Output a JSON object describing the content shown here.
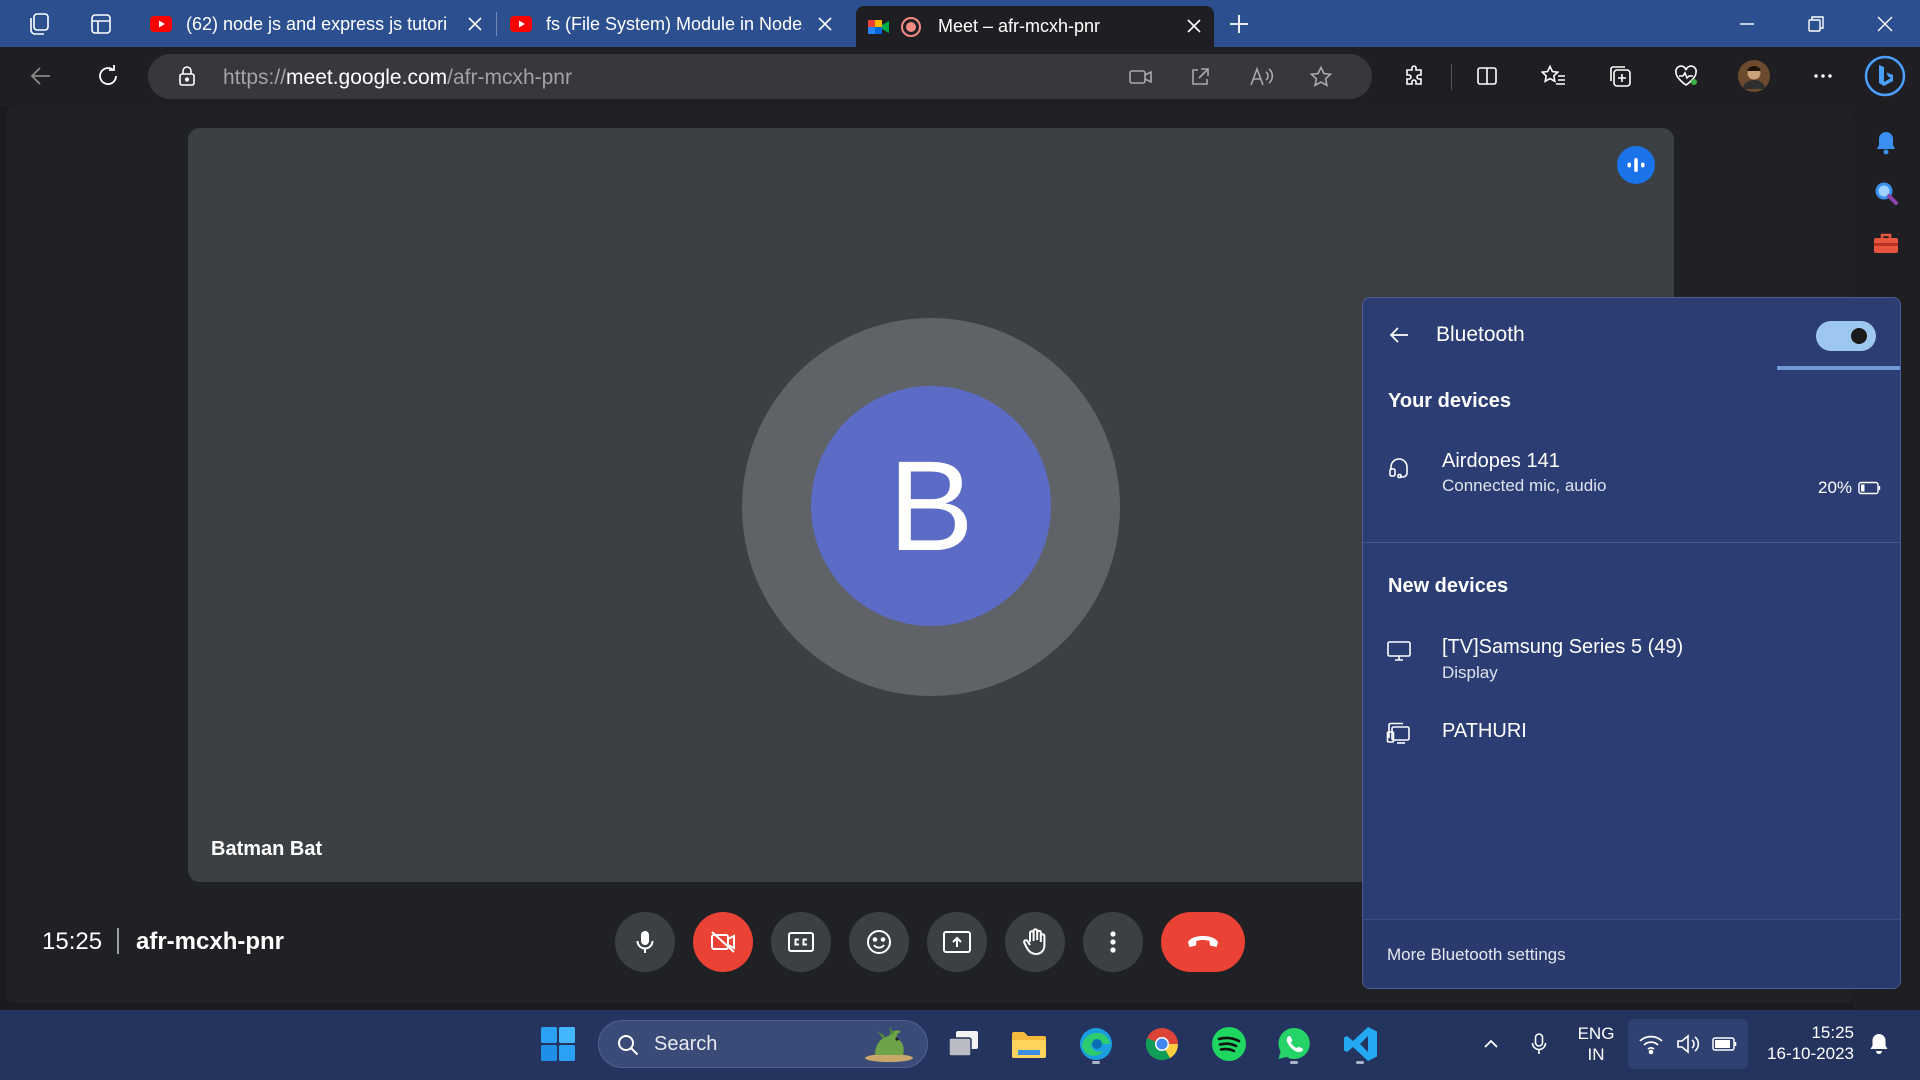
{
  "browser": {
    "tabs": [
      {
        "title": "(62) node js and express js tutori",
        "icon": "youtube-icon"
      },
      {
        "title": "fs (File System) Module in Node.J",
        "icon": "youtube-icon"
      },
      {
        "title": "Meet – afr-mcxh-pnr",
        "icon": "google-meet-icon",
        "active": true
      }
    ],
    "url_prefix": "https://",
    "url_domain": "meet.google.com",
    "url_path": "/afr-mcxh-pnr"
  },
  "meet": {
    "avatar_letter": "B",
    "participant_name": "Batman Bat",
    "time": "15:25",
    "meeting_code": "afr-mcxh-pnr",
    "controls": [
      "mic-icon",
      "camera-off-icon",
      "captions-icon",
      "emoji-icon",
      "present-icon",
      "raise-hand-icon",
      "more-icon",
      "end-call-icon"
    ]
  },
  "bluetooth": {
    "title": "Bluetooth",
    "enabled": true,
    "your_devices_heading": "Your devices",
    "your_devices": [
      {
        "name": "Airdopes 141",
        "status": "Connected mic, audio",
        "battery": "20%",
        "icon": "headset-icon"
      }
    ],
    "new_devices_heading": "New devices",
    "new_devices": [
      {
        "name": "[TV]Samsung Series 5 (49)",
        "status": "Display",
        "icon": "monitor-icon"
      },
      {
        "name": "PATHURI",
        "status": "",
        "icon": "devices-icon"
      }
    ],
    "more_settings": "More Bluetooth settings"
  },
  "taskbar": {
    "search_placeholder": "Search",
    "lang_line1": "ENG",
    "lang_line2": "IN",
    "time": "15:25",
    "date": "16-10-2023"
  },
  "colors": {
    "tab_strip": "#2c4f8f",
    "meet_bg": "#202124",
    "tile_bg": "#3c4043",
    "avatar": "#5b6bc6",
    "end_call": "#ea4335",
    "flyout": "#2b3d73",
    "taskbar": "#24345f"
  }
}
